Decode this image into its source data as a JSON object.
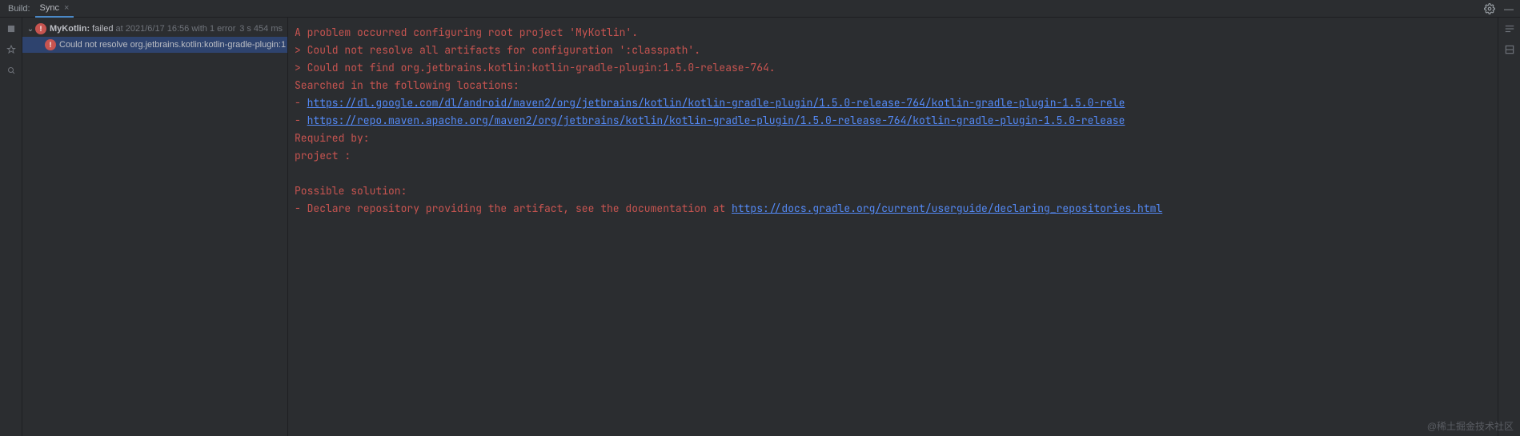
{
  "header": {
    "label": "Build:",
    "tab": "Sync"
  },
  "tree": {
    "root": {
      "name": "MyKotlin:",
      "status": "failed",
      "timestamp": "at 2021/6/17 16:56 with 1 error",
      "duration": "3 s 454 ms"
    },
    "child": {
      "message": "Could not resolve org.jetbrains.kotlin:kotlin-gradle-plugin:1"
    }
  },
  "console": {
    "line1": "A problem occurred configuring root project 'MyKotlin'.",
    "line2_prefix": "> ",
    "line2": "Could not resolve all artifacts for configuration ':classpath'.",
    "line3_prefix": "   > ",
    "line3": "Could not find org.jetbrains.kotlin:kotlin-gradle-plugin:1.5.0-release-764.",
    "line4": "     Searched in the following locations:",
    "line5_prefix": "       - ",
    "link1": "https://dl.google.com/dl/android/maven2/org/jetbrains/kotlin/kotlin-gradle-plugin/1.5.0-release-764/kotlin-gradle-plugin-1.5.0-rele",
    "line6_prefix": "       - ",
    "link2": "https://repo.maven.apache.org/maven2/org/jetbrains/kotlin/kotlin-gradle-plugin/1.5.0-release-764/kotlin-gradle-plugin-1.5.0-release",
    "line7": "     Required by:",
    "line8": "         project :",
    "solution_header": "Possible solution:",
    "solution_prefix": " - ",
    "solution_text": "Declare repository providing the artifact, see the documentation at ",
    "solution_link": "https://docs.gradle.org/current/userguide/declaring_repositories.html"
  },
  "watermark": "@稀土掘金技术社区"
}
